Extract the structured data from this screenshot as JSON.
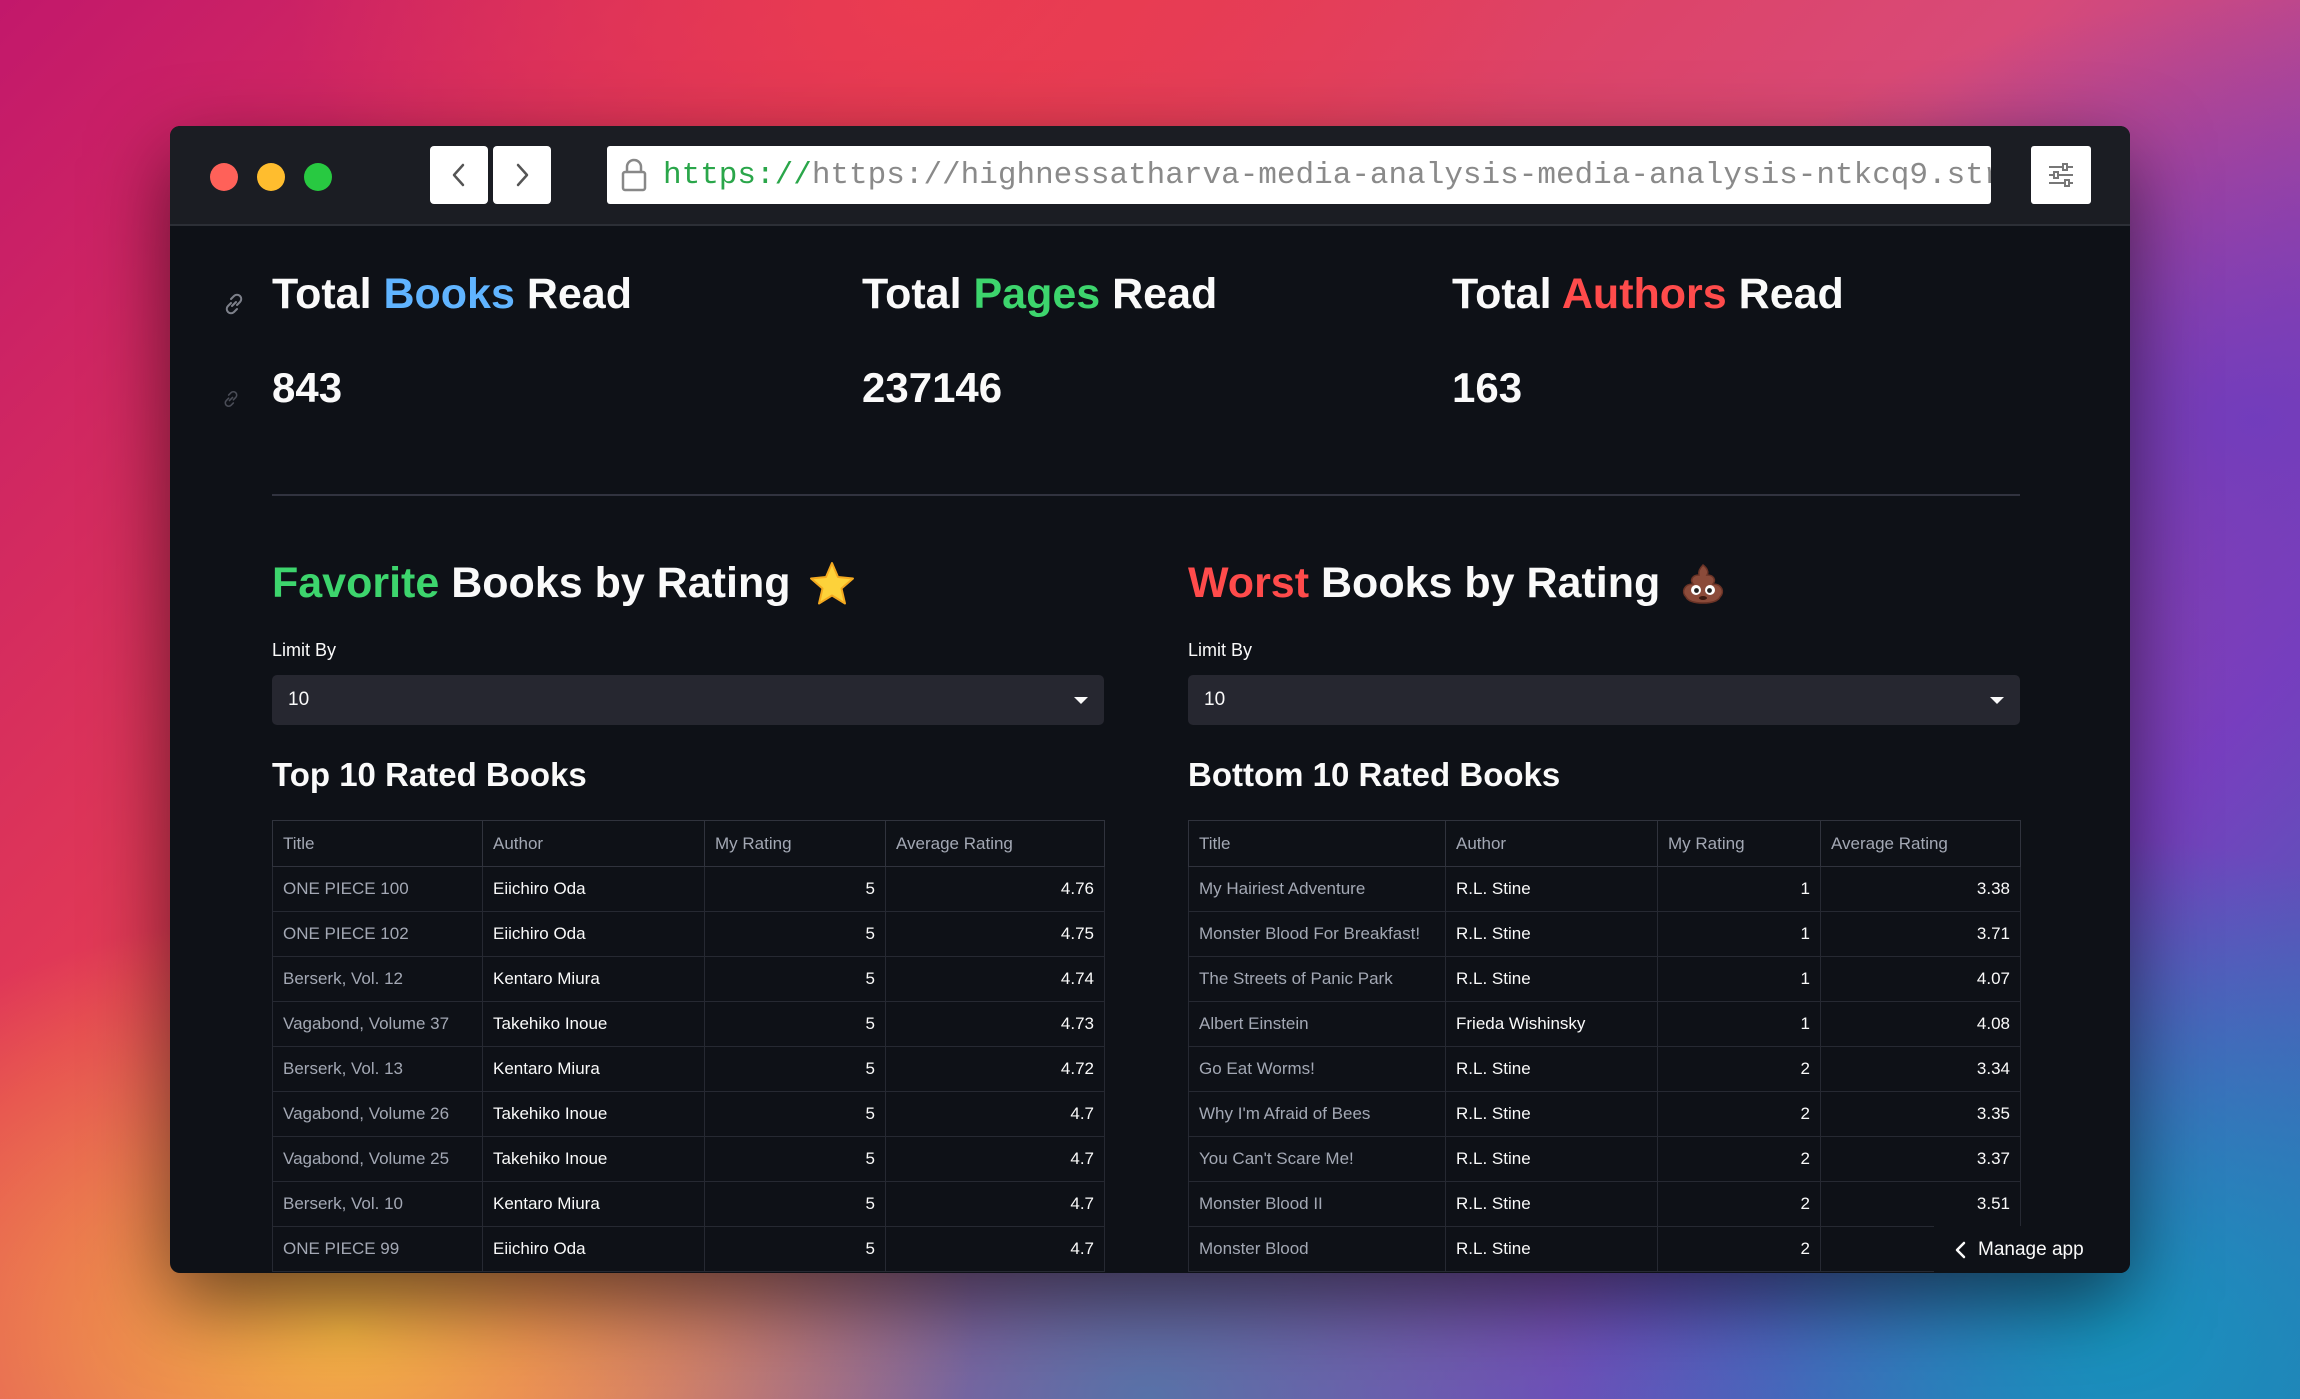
{
  "browser": {
    "url_scheme": "https://",
    "url_rest": "https://highnessatharva-media-analysis-media-analysis-ntkcq9.str",
    "back_icon": "chevron-left-icon",
    "forward_icon": "chevron-right-icon",
    "menu_icon": "sliders-icon",
    "lock_icon": "lock-icon"
  },
  "metrics": [
    {
      "pre": "Total ",
      "accent": "Books",
      "post": " Read",
      "value": "843",
      "accent_color": "#60b4ff"
    },
    {
      "pre": "Total ",
      "accent": "Pages",
      "post": " Read",
      "value": "237146",
      "accent_color": "#3dd56d"
    },
    {
      "pre": "Total ",
      "accent": "Authors",
      "post": " Read",
      "value": "163",
      "accent_color": "#ff4b4b"
    }
  ],
  "favorite": {
    "title_accent": "Favorite",
    "title_rest": " Books by Rating",
    "emoji": "star-icon",
    "limit_label": "Limit By",
    "limit_value": "10",
    "table_title": "Top 10 Rated Books",
    "columns": [
      "Title",
      "Author",
      "My Rating",
      "Average Rating"
    ],
    "rows": [
      {
        "title": "ONE PIECE 100",
        "author": "Eiichiro Oda",
        "my_rating": "5",
        "avg_rating": "4.76"
      },
      {
        "title": "ONE PIECE 102",
        "author": "Eiichiro Oda",
        "my_rating": "5",
        "avg_rating": "4.75"
      },
      {
        "title": "Berserk, Vol. 12",
        "author": "Kentaro Miura",
        "my_rating": "5",
        "avg_rating": "4.74"
      },
      {
        "title": "Vagabond, Volume 37",
        "author": "Takehiko Inoue",
        "my_rating": "5",
        "avg_rating": "4.73"
      },
      {
        "title": "Berserk, Vol. 13",
        "author": "Kentaro Miura",
        "my_rating": "5",
        "avg_rating": "4.72"
      },
      {
        "title": "Vagabond, Volume 26",
        "author": "Takehiko Inoue",
        "my_rating": "5",
        "avg_rating": "4.7"
      },
      {
        "title": "Vagabond, Volume 25",
        "author": "Takehiko Inoue",
        "my_rating": "5",
        "avg_rating": "4.7"
      },
      {
        "title": "Berserk, Vol. 10",
        "author": "Kentaro Miura",
        "my_rating": "5",
        "avg_rating": "4.7"
      },
      {
        "title": "ONE PIECE 99",
        "author": "Eiichiro Oda",
        "my_rating": "5",
        "avg_rating": "4.7"
      }
    ]
  },
  "worst": {
    "title_accent": "Worst",
    "title_rest": " Books by Rating",
    "emoji": "poop-icon",
    "limit_label": "Limit By",
    "limit_value": "10",
    "table_title": "Bottom 10 Rated Books",
    "columns": [
      "Title",
      "Author",
      "My Rating",
      "Average Rating"
    ],
    "rows": [
      {
        "title": "My Hairiest Adventure",
        "author": "R.L. Stine",
        "my_rating": "1",
        "avg_rating": "3.38"
      },
      {
        "title": "Monster Blood For Breakfast!",
        "author": "R.L. Stine",
        "my_rating": "1",
        "avg_rating": "3.71"
      },
      {
        "title": "The Streets of Panic Park",
        "author": "R.L. Stine",
        "my_rating": "1",
        "avg_rating": "4.07"
      },
      {
        "title": "Albert Einstein",
        "author": "Frieda Wishinsky",
        "my_rating": "1",
        "avg_rating": "4.08"
      },
      {
        "title": "Go Eat Worms!",
        "author": "R.L. Stine",
        "my_rating": "2",
        "avg_rating": "3.34"
      },
      {
        "title": "Why I'm Afraid of Bees",
        "author": "R.L. Stine",
        "my_rating": "2",
        "avg_rating": "3.35"
      },
      {
        "title": "You Can't Scare Me!",
        "author": "R.L. Stine",
        "my_rating": "2",
        "avg_rating": "3.37"
      },
      {
        "title": "Monster Blood II",
        "author": "R.L. Stine",
        "my_rating": "2",
        "avg_rating": "3.51"
      },
      {
        "title": "Monster Blood",
        "author": "R.L. Stine",
        "my_rating": "2",
        "avg_rating": ""
      }
    ]
  },
  "manage_app": {
    "label": "Manage app",
    "icon": "chevron-left-icon"
  }
}
